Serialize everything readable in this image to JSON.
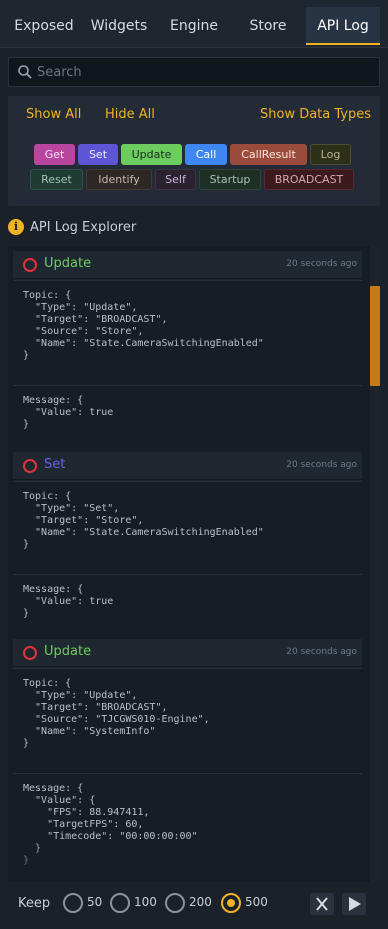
{
  "tabs": [
    {
      "label": "Exposed",
      "active": false
    },
    {
      "label": "Widgets",
      "active": false
    },
    {
      "label": "Engine",
      "active": false
    },
    {
      "label": "Store",
      "active": false
    },
    {
      "label": "API Log",
      "active": true
    }
  ],
  "search": {
    "placeholder": "Search",
    "value": ""
  },
  "filters": {
    "show_all": "Show All",
    "hide_all": "Hide All",
    "show_data_types": "Show Data Types",
    "chips": [
      "Get",
      "Set",
      "Update",
      "Call",
      "CallResult",
      "Log",
      "Reset",
      "Identify",
      "Self",
      "Startup",
      "BROADCAST"
    ]
  },
  "section_title": "API Log Explorer",
  "colors": {
    "accent": "#f0b323",
    "update": "#6dcc5e",
    "set": "#5d55d6",
    "error_ring": "#e2323a",
    "scrollbar": "#c67a16"
  },
  "log": [
    {
      "type": "Update",
      "time": "20 seconds ago",
      "topic": "Topic: {\n  \"Type\": \"Update\",\n  \"Target\": \"BROADCAST\",\n  \"Source\": \"Store\",\n  \"Name\": \"State.CameraSwitchingEnabled\"\n}",
      "message": "Message: {\n  \"Value\": true\n}"
    },
    {
      "type": "Set",
      "time": "20 seconds ago",
      "topic": "Topic: {\n  \"Type\": \"Set\",\n  \"Target\": \"Store\",\n  \"Name\": \"State.CameraSwitchingEnabled\"\n}",
      "message": "Message: {\n  \"Value\": true\n}"
    },
    {
      "type": "Update",
      "time": "20 seconds ago",
      "topic": "Topic: {\n  \"Type\": \"Update\",\n  \"Target\": \"BROADCAST\",\n  \"Source\": \"TJCGWS010-Engine\",\n  \"Name\": \"SystemInfo\"\n}",
      "message": "Message: {\n  \"Value\": {\n    \"FPS\": 88.947411,\n    \"TargetFPS\": 60,\n    \"Timecode\": \"00:00:00:00\"\n  }\n}"
    }
  ],
  "footer": {
    "keep_label": "Keep",
    "options": [
      "50",
      "100",
      "200",
      "500"
    ],
    "selected": "500",
    "clear_icon": "close-icon",
    "play_icon": "play-icon"
  }
}
